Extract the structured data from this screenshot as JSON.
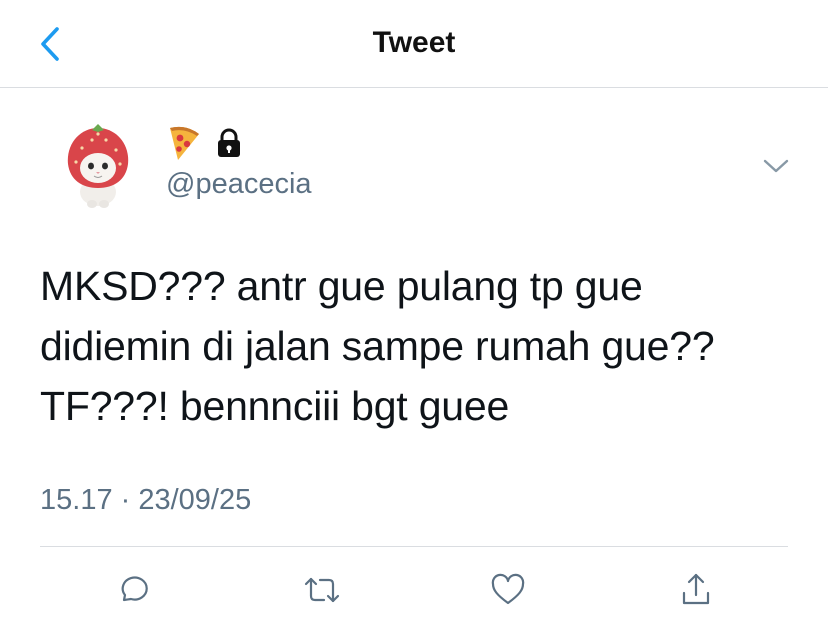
{
  "header": {
    "title": "Tweet",
    "back_icon": "chevron-left-icon",
    "accent_color": "#1d9bf0"
  },
  "author": {
    "display_emoji": "🍕",
    "locked_icon": "lock-icon",
    "handle": "@peacecia"
  },
  "tweet": {
    "lines": [
      "MKSD??? antr gue pulang tp gue",
      "didiemin di jalan sampe rumah gue??",
      "TF???! bennnciii bgt guee"
    ],
    "timestamp": "15.17 · 23/09/25"
  },
  "actions": {
    "icons": [
      "reply-icon",
      "retweet-icon",
      "like-icon",
      "share-icon"
    ],
    "color": "#5b7083"
  }
}
